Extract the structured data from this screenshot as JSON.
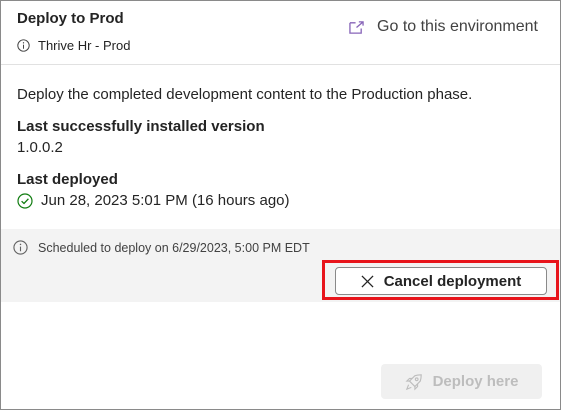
{
  "panel": {
    "title": "Deploy to Prod",
    "environment_name": "Thrive Hr - Prod",
    "go_to_environment_label": "Go to this environment"
  },
  "content": {
    "description": "Deploy the completed development content to the Production phase.",
    "installed_version_label": "Last successfully installed version",
    "installed_version_value": "1.0.0.2",
    "last_deployed_label": "Last deployed",
    "last_deployed_value": "Jun 28, 2023 5:01 PM (16 hours ago)"
  },
  "schedule": {
    "message": "Scheduled to deploy on 6/29/2023, 5:00 PM EDT",
    "cancel_label": "Cancel deployment"
  },
  "footer": {
    "deploy_label": "Deploy here",
    "deploy_enabled": false
  },
  "colors": {
    "highlight": "#e8141b",
    "success": "#107c10",
    "link_icon": "#8764b8"
  },
  "icons": [
    "info-icon",
    "open-external-icon",
    "check-circle-icon",
    "close-icon",
    "rocket-icon"
  ]
}
